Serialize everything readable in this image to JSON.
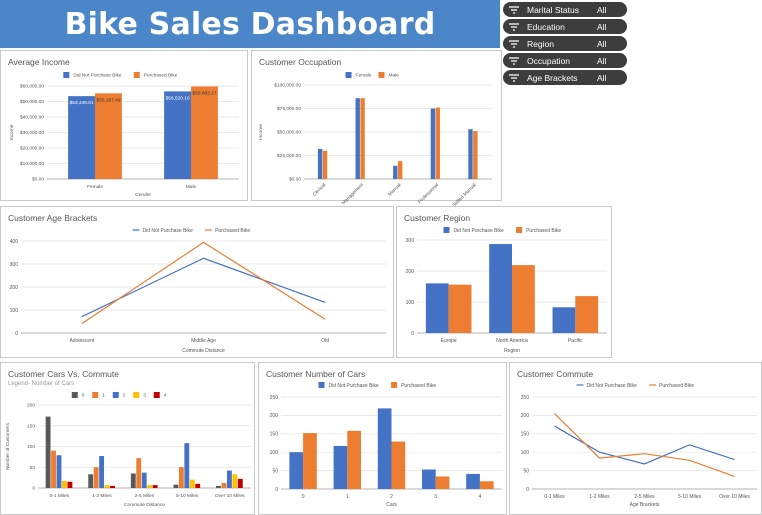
{
  "header": {
    "title": "Bike Sales Dashboard"
  },
  "filters": [
    {
      "label": "Marital Status",
      "value": "All"
    },
    {
      "label": "Education",
      "value": "All"
    },
    {
      "label": "Region",
      "value": "All"
    },
    {
      "label": "Occupation",
      "value": "All"
    },
    {
      "label": "Age Brackets",
      "value": "All"
    }
  ],
  "colors": {
    "blue": "#4472c4",
    "orange": "#ed7d31",
    "gray": "#595959",
    "yellow": "#ffc000",
    "red": "#c00000",
    "banner": "#4a86c8"
  },
  "chart_data": [
    {
      "id": "income",
      "type": "bar",
      "title": "Average Income",
      "xlabel": "Gender",
      "ylabel": "Income",
      "categories": [
        "Female",
        "Male"
      ],
      "series": [
        {
          "name": "Did Not Purchase Bike",
          "values": [
            53449.61,
            56520.16
          ]
        },
        {
          "name": "Purchased Bike",
          "values": [
            55267.49,
            59683.17
          ]
        }
      ],
      "data_labels": [
        [
          "$53,449.61",
          "$55,267.49"
        ],
        [
          "$56,520.16",
          "$59,683.17"
        ]
      ],
      "ylim": [
        0,
        60000
      ],
      "yticks": [
        0,
        10000,
        20000,
        30000,
        40000,
        50000,
        60000
      ],
      "ytick_labels": [
        "$0.00",
        "$10,000.00",
        "$20,000.00",
        "$30,000.00",
        "$40,000.00",
        "$50,000.00",
        "$60,000.00"
      ],
      "legend": "top"
    },
    {
      "id": "occupation",
      "type": "bar",
      "title": "Customer Occupation",
      "xlabel": "",
      "ylabel": "Income",
      "categories": [
        "Clerical",
        "Management",
        "Manual",
        "Professional",
        "Skilled Manual"
      ],
      "series": [
        {
          "name": "Female",
          "values": [
            32000,
            86000,
            14000,
            75000,
            53000
          ]
        },
        {
          "name": "Male",
          "values": [
            30000,
            86000,
            19000,
            76000,
            51000
          ]
        }
      ],
      "ylim": [
        0,
        100000
      ],
      "yticks": [
        0,
        25000,
        50000,
        75000,
        100000
      ],
      "ytick_labels": [
        "$0.00",
        "$25,000.00",
        "$50,000.00",
        "$75,000.00",
        "$100,000.00"
      ],
      "legend": "top"
    },
    {
      "id": "age",
      "type": "line",
      "title": "Customer Age Brackets",
      "xlabel": "Commute Distance",
      "ylabel": "",
      "categories": [
        "Adolescent",
        "Middle Age",
        "Old"
      ],
      "series": [
        {
          "name": "Did Not Purchase Bike",
          "values": [
            71,
            325,
            133
          ]
        },
        {
          "name": "Purchased Bike",
          "values": [
            41,
            394,
            60
          ]
        }
      ],
      "ylim": [
        0,
        400
      ],
      "yticks": [
        0,
        100,
        200,
        300,
        400
      ],
      "legend": "top"
    },
    {
      "id": "region",
      "type": "bar",
      "title": "Customer Region",
      "xlabel": "Region",
      "ylabel": "",
      "categories": [
        "Europe",
        "North America",
        "Pacific"
      ],
      "series": [
        {
          "name": "Did Not Purchase Bike",
          "values": [
            160,
            287,
            83
          ]
        },
        {
          "name": "Purchased Bike",
          "values": [
            156,
            219,
            119
          ]
        }
      ],
      "ylim": [
        0,
        300
      ],
      "yticks": [
        0,
        100,
        200,
        300
      ],
      "legend": "top"
    },
    {
      "id": "cars_commute",
      "type": "bar",
      "title": "Customer Cars Vs. Commute",
      "subtitle": "Legend- Number of Cars",
      "xlabel": "Commute Distance",
      "ylabel": "Number of Customers",
      "categories": [
        "0-1 Miles",
        "1-2 Miles",
        "2-5 Miles",
        "5-10 Miles",
        "Over 10 Miles"
      ],
      "series": [
        {
          "name": "0",
          "values": [
            172,
            33,
            35,
            8,
            5
          ]
        },
        {
          "name": "1",
          "values": [
            90,
            50,
            72,
            50,
            12
          ]
        },
        {
          "name": "2",
          "values": [
            79,
            77,
            37,
            108,
            42
          ]
        },
        {
          "name": "3",
          "values": [
            17,
            7,
            7,
            20,
            33
          ]
        },
        {
          "name": "4",
          "values": [
            15,
            5,
            7,
            10,
            22
          ]
        }
      ],
      "ylim": [
        0,
        200
      ],
      "yticks": [
        0,
        50,
        100,
        150,
        200
      ],
      "legend": "top"
    },
    {
      "id": "num_cars",
      "type": "bar",
      "title": "Customer Number of Cars",
      "xlabel": "Cars",
      "ylabel": "",
      "categories": [
        "0",
        "1",
        "2",
        "3",
        "4"
      ],
      "series": [
        {
          "name": "Did Not Purchase Bike",
          "values": [
            100,
            117,
            219,
            53,
            41
          ]
        },
        {
          "name": "Purchased Bike",
          "values": [
            152,
            158,
            129,
            34,
            21
          ]
        }
      ],
      "ylim": [
        0,
        250
      ],
      "yticks": [
        0,
        50,
        100,
        150,
        200,
        250
      ],
      "legend": "top"
    },
    {
      "id": "commute",
      "type": "line",
      "title": "Customer Commute",
      "xlabel": "Age Brackets",
      "ylabel": "",
      "categories": [
        "0-1 Miles",
        "1-2 Miles",
        "2-5 Miles",
        "5-10 Miles",
        "Over 10 Miles"
      ],
      "series": [
        {
          "name": "Did Not Purchase Bike",
          "values": [
            171,
            100,
            68,
            120,
            80
          ]
        },
        {
          "name": "Purchased Bike",
          "values": [
            205,
            84,
            96,
            78,
            34
          ]
        }
      ],
      "ylim": [
        0,
        250
      ],
      "yticks": [
        0,
        50,
        100,
        150,
        200,
        250
      ],
      "legend": "top"
    }
  ]
}
